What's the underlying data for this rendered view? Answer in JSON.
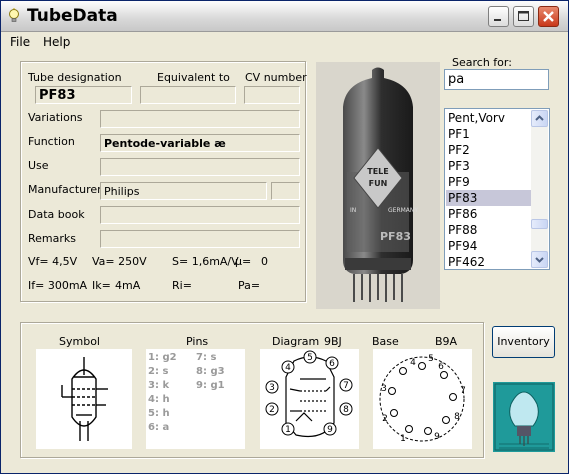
{
  "app": {
    "title": "TubeData"
  },
  "menu": {
    "file": "File",
    "help": "Help"
  },
  "tube": {
    "designation_label": "Tube designation",
    "equivalent_label": "Equivalent to",
    "cv_label": "CV number",
    "designation": "PF83",
    "equivalent": "",
    "cv_number": "",
    "variations_label": "Variations",
    "variations": "",
    "function_label": "Function",
    "function": "Pentode-variable æ",
    "use_label": "Use",
    "use": "",
    "manufacturer_label": "Manufacturer",
    "manufacturer": "Philips",
    "manufacturer_extra": "",
    "databook_label": "Data book",
    "databook": "",
    "remarks_label": "Remarks",
    "remarks": ""
  },
  "params": {
    "vf": "Vf= 4,5V",
    "va": "Va= 250V",
    "s": "S= 1,6mA/V",
    "mu": "µ=",
    "mu_val": "0",
    "if": "If= 300mA",
    "ik": "Ik=",
    "ik_val": "4mA",
    "ri": "Ri=",
    "pa": "Pa="
  },
  "search": {
    "label": "Search for:",
    "value": "pa",
    "results": [
      "Pent,Vorv",
      "PF1",
      "PF2",
      "PF3",
      "PF9",
      "PF83",
      "PF86",
      "PF88",
      "PF94",
      "PF462"
    ],
    "selected": "PF83"
  },
  "bottom": {
    "symbol_label": "Symbol",
    "pins_label": "Pins",
    "diagram_label": "Diagram",
    "diagram_code": "9BJ",
    "base_label": "Base",
    "base_code": "B9A",
    "pins_left": [
      "1: g2",
      "2: s",
      "3: k",
      "4: h",
      "5: h",
      "6: a"
    ],
    "pins_right": [
      "7: s",
      "8: g3",
      "9: g1"
    ],
    "base_pin_numbers": [
      "1",
      "2",
      "3",
      "4",
      "5",
      "6",
      "7",
      "8",
      "9"
    ]
  },
  "buttons": {
    "inventory": "Inventory"
  },
  "photo": {
    "print_lines": [
      "TELE",
      "FUN",
      "IN",
      "GERMANY",
      "PF83"
    ]
  },
  "logo": {
    "name": "tube-data-logo"
  }
}
